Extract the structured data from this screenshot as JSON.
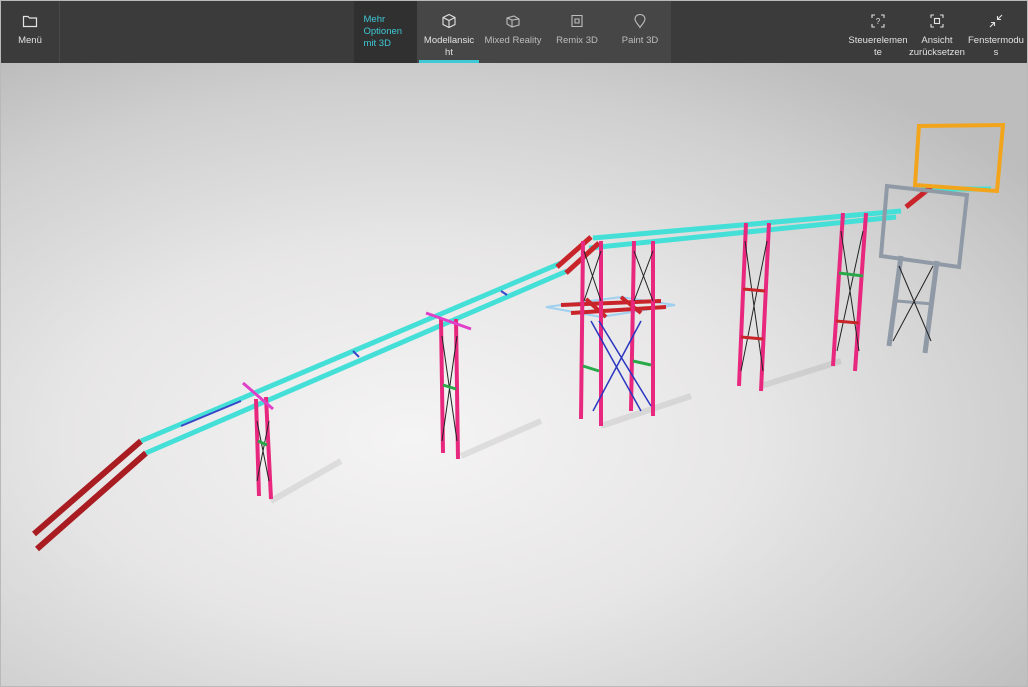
{
  "toolbar": {
    "menu_label": "Menü",
    "more_options_label": "Mehr Optionen mit 3D",
    "tabs": [
      {
        "label": "Modellansic ht",
        "active": true,
        "icon": "cube-icon"
      },
      {
        "label": "Mixed Reality",
        "active": false,
        "icon": "mixed-reality-icon"
      },
      {
        "label": "Remix 3D",
        "active": false,
        "icon": "remix-3d-icon"
      },
      {
        "label": "Paint 3D",
        "active": false,
        "icon": "paint-3d-icon"
      }
    ],
    "right_buttons": [
      {
        "label": "Steuerelemen te",
        "icon": "controls-icon"
      },
      {
        "label": "Ansicht zurücksetzen",
        "icon": "reset-view-icon"
      },
      {
        "label": "Fenstermodu s",
        "icon": "window-mode-icon"
      }
    ],
    "colors": {
      "background": "#3b3b3b",
      "accent": "#3fc9d6"
    }
  },
  "viewport": {
    "content": "3D conveyor bridge model",
    "colors": {
      "belt": "#44e0d8",
      "trestle": "#e8287e",
      "ramp": "#a81c22",
      "bracing": "#222222",
      "tower_grey": "#8f9aa6",
      "hopper": "#f2a51c"
    }
  }
}
